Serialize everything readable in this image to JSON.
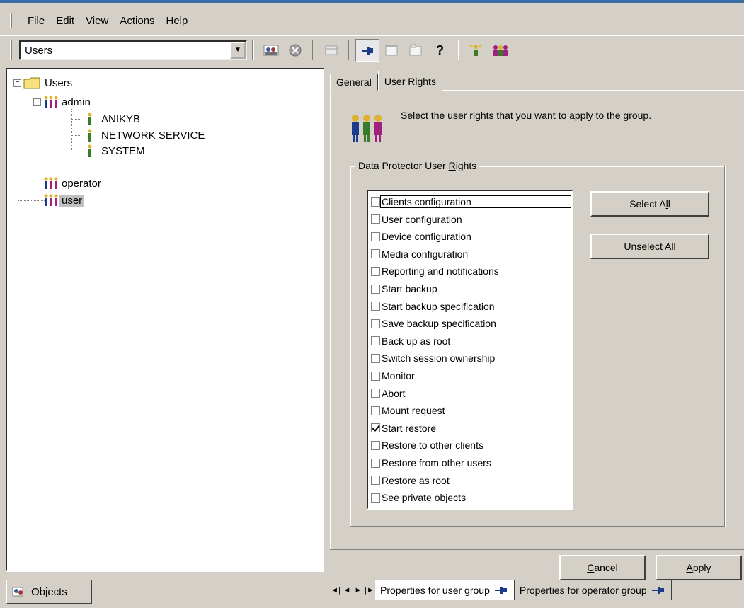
{
  "menu": {
    "items": [
      {
        "label": "File",
        "accel": "F"
      },
      {
        "label": "Edit",
        "accel": "E"
      },
      {
        "label": "View",
        "accel": "V"
      },
      {
        "label": "Actions",
        "accel": "A"
      },
      {
        "label": "Help",
        "accel": "H"
      }
    ]
  },
  "toolbar": {
    "context_value": "Users",
    "icons": [
      "users-icon",
      "stop-icon",
      "disabled-icon",
      "pin-icon",
      "window-icon",
      "window-tab-icon",
      "help-icon",
      "add-user-icon",
      "add-group-icon"
    ]
  },
  "tree": {
    "root": "Users",
    "groups": [
      {
        "label": "admin",
        "members": [
          "ANIKYB",
          "NETWORK SERVICE",
          "SYSTEM"
        ]
      },
      {
        "label": "operator"
      },
      {
        "label": "user",
        "selected": true
      }
    ]
  },
  "left_tab": {
    "label": "Objects"
  },
  "tabs": [
    "General",
    "User Rights"
  ],
  "active_tab": "User Rights",
  "header_text": "Select the user rights that you want to apply to the group.",
  "group": {
    "title_pre": "Data Protector User ",
    "title_accel": "R",
    "title_post": "ights"
  },
  "rights": [
    {
      "label": "Clients configuration",
      "checked": false
    },
    {
      "label": "User configuration",
      "checked": false
    },
    {
      "label": "Device configuration",
      "checked": false
    },
    {
      "label": "Media configuration",
      "checked": false
    },
    {
      "label": "Reporting and notifications",
      "checked": false
    },
    {
      "label": "Start backup",
      "checked": false
    },
    {
      "label": "Start backup specification",
      "checked": false
    },
    {
      "label": "Save backup specification",
      "checked": false
    },
    {
      "label": "Back up as root",
      "checked": false
    },
    {
      "label": "Switch session ownership",
      "checked": false
    },
    {
      "label": "Monitor",
      "checked": false
    },
    {
      "label": "Abort",
      "checked": false
    },
    {
      "label": "Mount request",
      "checked": false
    },
    {
      "label": "Start restore",
      "checked": true
    },
    {
      "label": "Restore to other clients",
      "checked": false
    },
    {
      "label": "Restore from other users",
      "checked": false
    },
    {
      "label": "Restore as root",
      "checked": false
    },
    {
      "label": "See private objects",
      "checked": false
    }
  ],
  "buttons": {
    "select_all_pre": "Select A",
    "select_all_accel": "l",
    "select_all_post": "l",
    "unselect_all_accel": "U",
    "unselect_all_post": "nselect All",
    "cancel_accel": "C",
    "cancel_post": "ancel",
    "apply_accel": "A",
    "apply_post": "pply"
  },
  "doc_tabs": [
    {
      "label": "Properties for user group",
      "active": true
    },
    {
      "label": "Properties for operator group",
      "active": false
    }
  ]
}
